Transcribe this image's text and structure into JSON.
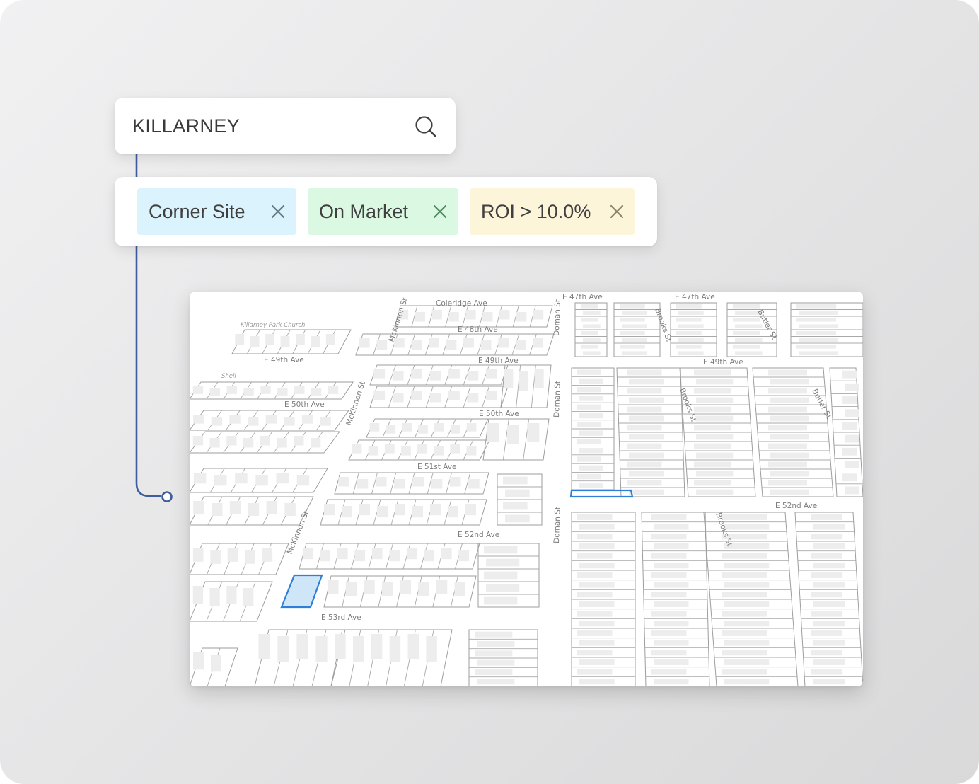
{
  "search": {
    "value": "KILLARNEY",
    "icon": "search-icon"
  },
  "filters": [
    {
      "label": "Corner Site",
      "background": "#daf3fd",
      "close_color": "#5f7b86",
      "close_icon": "close-icon"
    },
    {
      "label": "On Market",
      "background": "#daf8e2",
      "close_color": "#4f8a62",
      "close_icon": "close-icon"
    },
    {
      "label": "ROI > 10.0%",
      "background": "#fdf5d9",
      "close_color": "#8a846a",
      "close_icon": "close-icon"
    }
  ],
  "connector_color": "#3e5d9e",
  "map": {
    "highlight_color": "#2f7fd8",
    "highlight_fill": "#cfe5f8",
    "streets": {
      "e47_left": "E 47th Ave",
      "e47_right": "E 47th Ave",
      "coleridge": "Coleridge Ave",
      "e48": "E 48th Ave",
      "killarney_church": "Killarney Park Church",
      "shell": "Shell",
      "e49_left": "E 49th Ave",
      "e49_mid": "E 49th Ave",
      "e49_right": "E 49th Ave",
      "e50_left": "E 50th Ave",
      "e50_mid": "E 50th Ave",
      "e51": "E 51st Ave",
      "e52_mid": "E 52nd Ave",
      "e52_right": "E 52nd Ave",
      "e53": "E 53rd Ave",
      "mckinnon_top": "McKinnon St",
      "mckinnon_mid": "McKinnon St",
      "mckinnon_low": "McKinnon St",
      "doman_top": "Doman St",
      "doman_mid": "Doman St",
      "doman_low": "Doman St",
      "brooks_top": "Brooks St",
      "brooks_mid": "Brooks St",
      "brooks_low": "Brooks St",
      "butler_top": "Butler St",
      "butler_mid": "Butler St"
    }
  }
}
